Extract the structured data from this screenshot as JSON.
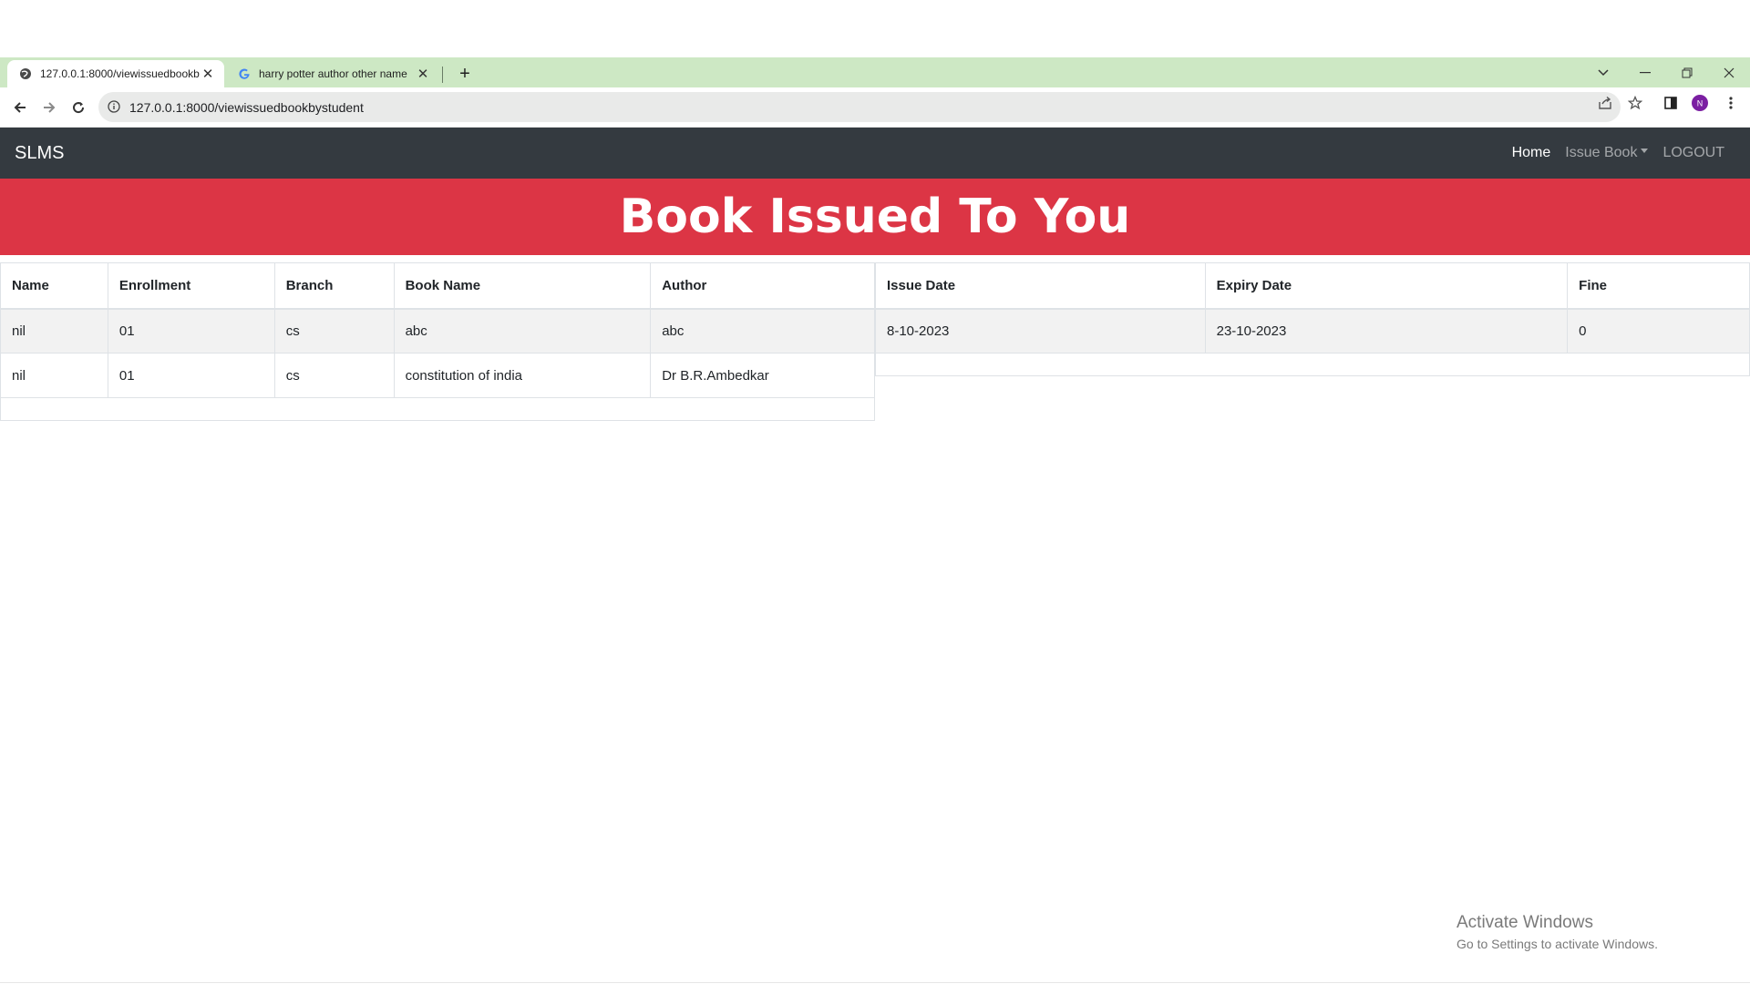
{
  "browser": {
    "tabs": [
      {
        "title": "127.0.0.1:8000/viewissuedbookb",
        "active": true,
        "icon": "globe-icon"
      },
      {
        "title": "harry potter author other name",
        "active": false,
        "icon": "google-icon"
      }
    ],
    "address_bar": {
      "url": "127.0.0.1:8000/viewissuedbookbystudent"
    },
    "profile_initial": "N",
    "accent": "#cde8c4"
  },
  "navbar": {
    "brand": "SLMS",
    "links": [
      {
        "label": "Home",
        "active": true
      },
      {
        "label": "Issue Book",
        "dropdown": true
      },
      {
        "label": "LOGOUT"
      }
    ]
  },
  "banner": {
    "title": "Book Issued To You",
    "color": "#dc3545"
  },
  "student_table": {
    "headers": [
      "Name",
      "Enrollment",
      "Branch",
      "Book Name",
      "Author"
    ],
    "rows": [
      [
        "nil",
        "01",
        "cs",
        "abc",
        "abc"
      ],
      [
        "nil",
        "01",
        "cs",
        "constitution of india",
        "Dr B.R.Ambedkar"
      ]
    ]
  },
  "issue_table": {
    "headers": [
      "Issue Date",
      "Expiry Date",
      "Fine"
    ],
    "rows": [
      [
        "8-10-2023",
        "23-10-2023",
        "0"
      ]
    ]
  },
  "watermark": {
    "line1": "Activate Windows",
    "line2": "Go to Settings to activate Windows."
  }
}
